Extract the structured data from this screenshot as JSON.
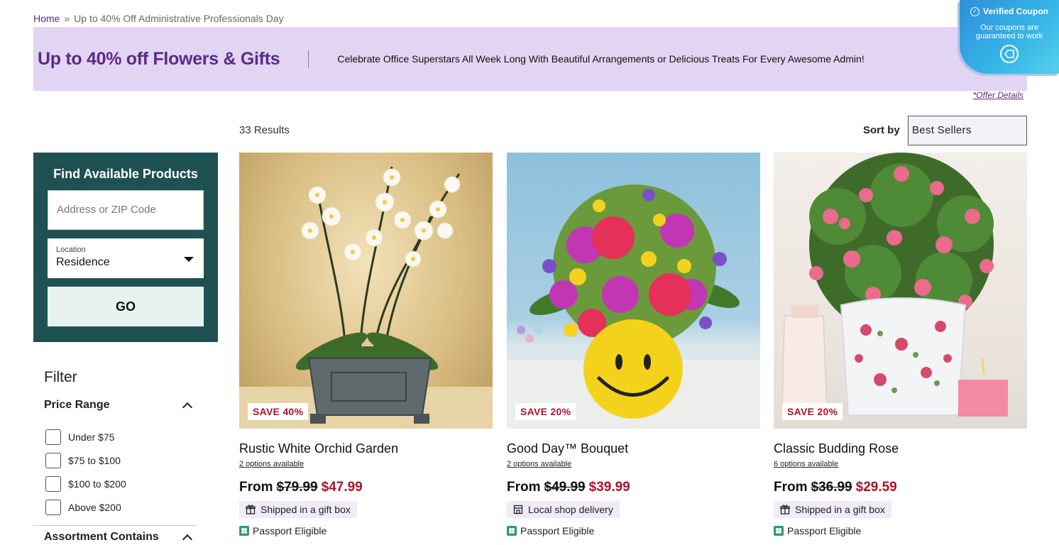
{
  "breadcrumb": {
    "home": "Home",
    "separator": "»",
    "current": "Up to 40% Off Administrative Professionals Day"
  },
  "banner": {
    "title": "Up to 40% off Flowers & Gifts",
    "text": "Celebrate Office Superstars All Week Long With Beautiful Arrangements or Delicious Treats For Every Awesome Admin!",
    "offer_details": "*Offer Details"
  },
  "coupon": {
    "title": "Verified Coupon",
    "subtitle": "Our coupons are guaranteed to work",
    "icon": "coupon-badge-icon"
  },
  "results": {
    "count": "33 Results",
    "sort_label": "Sort by",
    "sort_value": "Best Sellers"
  },
  "finder": {
    "title": "Find Available Products",
    "address_placeholder": "Address or ZIP Code",
    "location_label": "Location",
    "location_value": "Residence",
    "go_label": "GO"
  },
  "filter": {
    "title": "Filter",
    "price_range_label": "Price Range",
    "price_options": [
      "Under $75",
      "$75 to $100",
      "$100 to $200",
      "Above $200"
    ],
    "assortment_label": "Assortment Contains"
  },
  "products": [
    {
      "name": "Rustic White Orchid Garden",
      "save": "SAVE 40%",
      "options": "2 options available",
      "from": "From",
      "old_price": "$79.99",
      "new_price": "$47.99",
      "delivery": "Shipped in a gift box",
      "delivery_icon": "gift-box-icon",
      "passport": "Passport Eligible"
    },
    {
      "name": "Good Day™ Bouquet",
      "save": "SAVE 20%",
      "options": "2 options available",
      "from": "From",
      "old_price": "$49.99",
      "new_price": "$39.99",
      "delivery": "Local shop delivery",
      "delivery_icon": "shop-icon",
      "passport": "Passport Eligible"
    },
    {
      "name": "Classic Budding Rose",
      "save": "SAVE 20%",
      "options": "6 options available",
      "from": "From",
      "old_price": "$36.99",
      "new_price": "$29.59",
      "delivery": "Shipped in a gift box",
      "delivery_icon": "gift-box-icon",
      "passport": "Passport Eligible"
    }
  ],
  "colors": {
    "brand_purple": "#5b2a86",
    "banner_bg": "#e2d4f3",
    "finder_bg": "#1f5152",
    "sale_red": "#b0102c"
  }
}
